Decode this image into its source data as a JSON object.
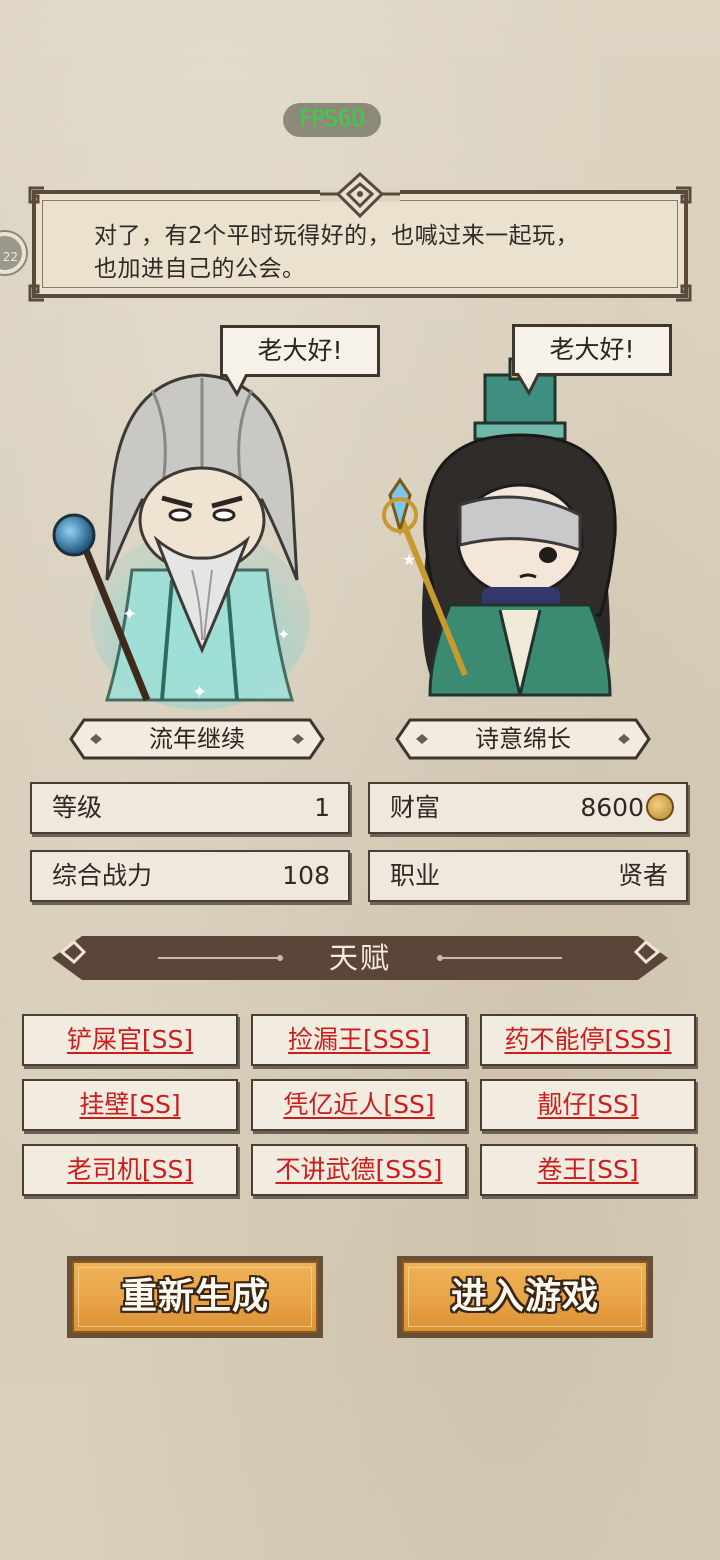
{
  "status": {
    "fps": "FPS60"
  },
  "side_button": {
    "label": "22"
  },
  "dialog": {
    "line1": "对了，有2个平时玩得好的，也喊过来一起玩，",
    "line2": "也加进自己的公会。"
  },
  "characters": [
    {
      "greeting": "老大好!",
      "name": "流年继续",
      "portrait": "elder-sage-portrait"
    },
    {
      "greeting": "老大好!",
      "name": "诗意绵长",
      "portrait": "young-scholar-portrait"
    }
  ],
  "stats": {
    "level": {
      "label": "等级",
      "value": "1"
    },
    "wealth": {
      "label": "财富",
      "value": "8600",
      "icon": "coin-icon"
    },
    "power": {
      "label": "综合战力",
      "value": "108"
    },
    "profession": {
      "label": "职业",
      "value": "贤者"
    }
  },
  "talents": {
    "title": "天赋",
    "items": [
      "铲屎官[SS]",
      "捡漏王[SSS]",
      "药不能停[SSS]",
      "挂壁[SS]",
      "凭亿近人[SS]",
      "靓仔[SS]",
      "老司机[SS]",
      "不讲武德[SSS]",
      "卷王[SS]"
    ]
  },
  "buttons": {
    "regenerate": "重新生成",
    "enter_game": "进入游戏"
  },
  "colors": {
    "talent_text": "#cc1d1d",
    "button": "#e8a447",
    "banner": "#5b4538",
    "fps_text": "#34d43e"
  }
}
